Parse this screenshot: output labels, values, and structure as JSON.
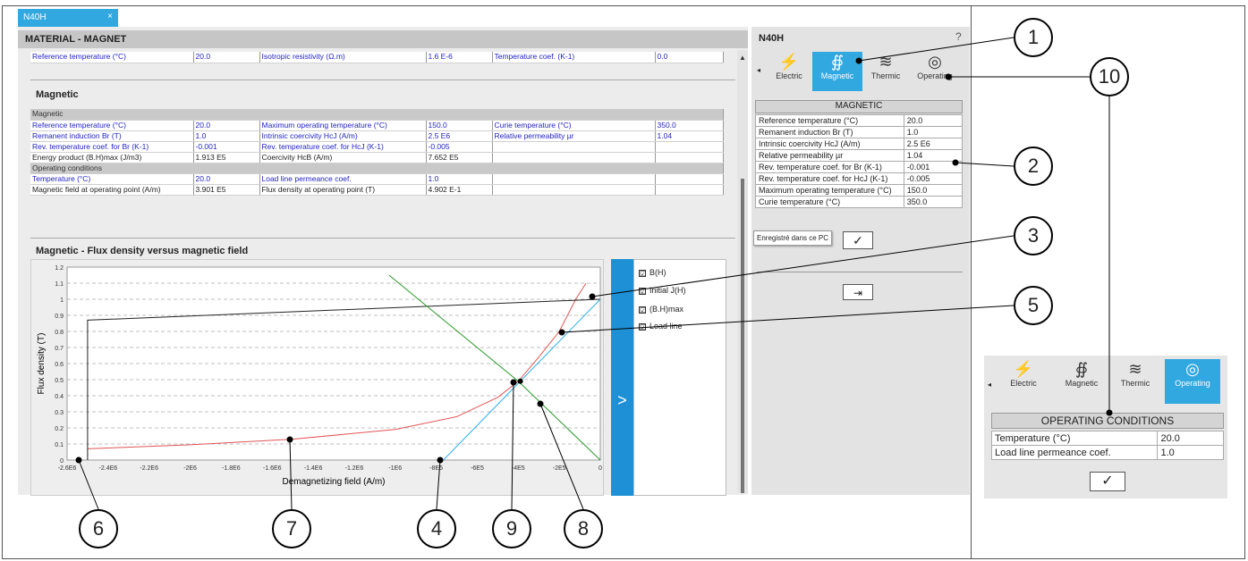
{
  "tab": {
    "label": "N40H",
    "close": "×"
  },
  "main": {
    "header": "MATERIAL - MAGNET",
    "top_row": [
      "Reference temperature (°C)",
      "20.0",
      "Isotropic resistivity (Ω.m)",
      "1.6 E-6",
      "Temperature coef. (K-1)",
      "0.0"
    ],
    "magnetic_title": "Magnetic",
    "magnetic_table": {
      "group1": "Magnetic",
      "rows1": [
        [
          "Reference temperature (°C)",
          "20.0",
          "Maximum operating temperature (°C)",
          "150.0",
          "Curie temperature (°C)",
          "350.0"
        ],
        [
          "Remanent induction Br (T)",
          "1.0",
          "Intrinsic coercivity HcJ (A/m)",
          "2.5 E6",
          "Relative permeability µr",
          "1.04"
        ],
        [
          "Rev. temperature coef. for Br (K-1)",
          "-0.001",
          "Rev. temperature coef. for HcJ (K-1)",
          "-0.005",
          "",
          ""
        ],
        [
          "Energy product (B.H)max (J/m3)",
          "1.913 E5",
          "Coercivity HcB (A/m)",
          "7.652 E5",
          "",
          ""
        ]
      ],
      "group2": "Operating conditions",
      "rows2": [
        [
          "Temperature (°C)",
          "20.0",
          "Load line permeance coef.",
          "1.0",
          "",
          ""
        ],
        [
          "Magnetic field at operating point (A/m)",
          "3.901 E5",
          "Flux density at operating point (T)",
          "4.902 E-1",
          "",
          ""
        ]
      ]
    },
    "chart_title": "Magnetic - Flux density versus magnetic field",
    "expand_arrow": ">"
  },
  "chart_data": {
    "type": "line",
    "xlabel": "Demagnetizing field (A/m)",
    "ylabel": "Flux density (T)",
    "xlim": [
      -2600000,
      0
    ],
    "ylim": [
      0,
      1.2
    ],
    "x_ticks": [
      "-2.6E6",
      "-2.4E6",
      "-2.2E6",
      "-2E6",
      "-1.8E6",
      "-1.6E6",
      "-1.4E6",
      "-1.2E6",
      "-1E6",
      "-8E5",
      "-6E5",
      "-4E5",
      "-2E5",
      "0"
    ],
    "y_ticks": [
      "0",
      "0.1",
      "0.2",
      "0.3",
      "0.4",
      "0.5",
      "0.6",
      "0.7",
      "0.8",
      "0.9",
      "1",
      "1.1",
      "1.2"
    ],
    "grid": true,
    "series": [
      {
        "name": "B(H)",
        "color": "#e05555",
        "x": [
          -2500000,
          -2000000,
          -1500000,
          -1000000,
          -700000,
          -500000,
          -400000,
          -300000,
          -200000,
          -120000,
          -70000
        ],
        "y": [
          0.07,
          0.095,
          0.13,
          0.19,
          0.27,
          0.39,
          0.49,
          0.64,
          0.8,
          1.0,
          1.1
        ]
      },
      {
        "name": "Initial J(H)",
        "color": "#222222",
        "x": [
          -2500000,
          -2500000,
          0
        ],
        "y": [
          0.0,
          0.87,
          1.0
        ]
      },
      {
        "name": "(B.H)max",
        "color": "#2db0e8",
        "x": [
          -765200,
          0
        ],
        "y": [
          0.0,
          1.0
        ]
      },
      {
        "name": "Load line",
        "color": "#2a9a2a",
        "x": [
          -1030000,
          -400000,
          0
        ],
        "y": [
          1.15,
          0.49,
          0.0
        ]
      }
    ],
    "operating_point": {
      "x": -390100,
      "y": 0.4902
    }
  },
  "legend": [
    {
      "label": "B(H)",
      "checked": "☑"
    },
    {
      "label": "Initial J(H)",
      "checked": "☑"
    },
    {
      "label": "(B.H)max",
      "checked": "☑"
    },
    {
      "label": "Load line",
      "checked": "☑"
    }
  ],
  "right": {
    "title": "N40H",
    "help": "?",
    "tabs": [
      {
        "label": "Electric",
        "icon": "⚡"
      },
      {
        "label": "Magnetic",
        "icon": "∯"
      },
      {
        "label": "Thermic",
        "icon": "≋"
      },
      {
        "label": "Operating",
        "icon": "◎"
      }
    ],
    "scroll_left": "◂",
    "section": "MAGNETIC",
    "rows": [
      [
        "Reference temperature (°C)",
        "20.0"
      ],
      [
        "Remanent induction Br (T)",
        "1.0"
      ],
      [
        "Intrinsic coercivity HcJ (A/m)",
        "2.5 E6"
      ],
      [
        "Relative permeability µr",
        "1.04"
      ],
      [
        "Rev. temperature coef. for Br (K-1)",
        "-0.001"
      ],
      [
        "Rev. temperature coef. for HcJ (K-1)",
        "-0.005"
      ],
      [
        "Maximum operating temperature (°C)",
        "150.0"
      ],
      [
        "Curie temperature (°C)",
        "350.0"
      ]
    ],
    "tooltip": "Enregistré dans ce PC",
    "check": "✓",
    "export_icon": "⇥"
  },
  "mini": {
    "section": "OPERATING CONDITIONS",
    "rows": [
      [
        "Temperature (°C)",
        "20.0"
      ],
      [
        "Load line permeance coef.",
        "1.0"
      ]
    ],
    "check": "✓"
  },
  "callouts": [
    "1",
    "2",
    "3",
    "4",
    "5",
    "6",
    "7",
    "8",
    "9",
    "10"
  ]
}
